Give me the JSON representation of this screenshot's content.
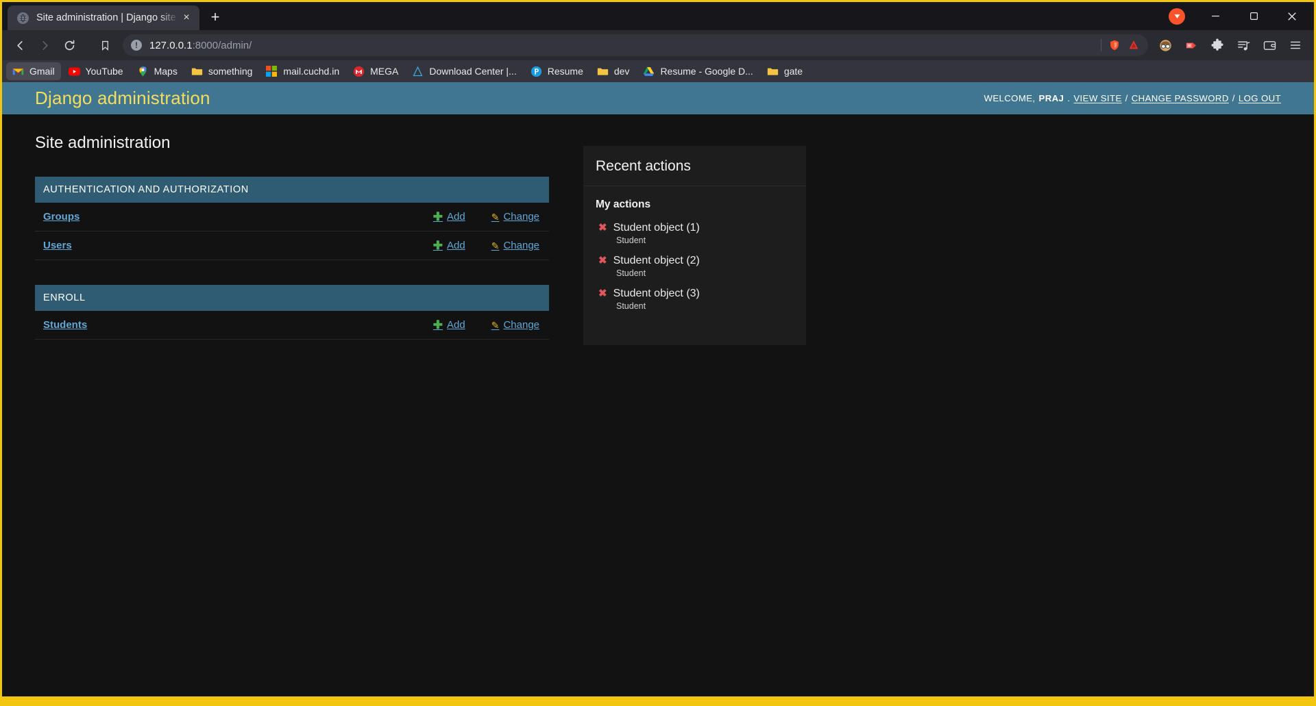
{
  "browser": {
    "tab": {
      "title": "Site administration | Django site a",
      "favicon": "globe-icon",
      "close": "×"
    },
    "new_tab_label": "+",
    "window_controls": {
      "minimize": "—",
      "maximize": "❐",
      "close": "✕"
    },
    "nav": {
      "back": "back-icon",
      "forward": "forward-icon",
      "reload": "reload-icon"
    },
    "omnibox": {
      "host": "127.0.0.1",
      "path": ":8000/admin/",
      "info_glyph": "!",
      "bookmark_icon": "bookmark-icon",
      "shield_icon": "brave-shield-icon",
      "leo_icon": "brave-leo-icon"
    },
    "toolbar_icons": [
      "profile-avatar-icon",
      "brave-rewards-icon",
      "extensions-puzzle-icon",
      "playlist-icon",
      "wallet-icon",
      "main-menu-icon"
    ],
    "bookmarks": [
      {
        "label": "Gmail",
        "icon": "gmail-icon",
        "active": true
      },
      {
        "label": "YouTube",
        "icon": "youtube-icon",
        "active": false
      },
      {
        "label": "Maps",
        "icon": "google-maps-icon",
        "active": false
      },
      {
        "label": "something",
        "icon": "folder-icon",
        "active": false
      },
      {
        "label": "mail.cuchd.in",
        "icon": "microsoft-icon",
        "active": false
      },
      {
        "label": "MEGA",
        "icon": "mega-icon",
        "active": false
      },
      {
        "label": "Download Center |...",
        "icon": "download-center-icon",
        "active": false
      },
      {
        "label": "Resume",
        "icon": "p-circle-icon",
        "active": false
      },
      {
        "label": "dev",
        "icon": "folder-icon",
        "active": false
      },
      {
        "label": "Resume - Google D...",
        "icon": "google-drive-icon",
        "active": false
      },
      {
        "label": "gate",
        "icon": "folder-icon",
        "active": false
      }
    ]
  },
  "django": {
    "branding": "Django administration",
    "user_tools": {
      "welcome_prefix": "Welcome,",
      "username": "PRAJ",
      "period": ".",
      "view_site": "View site",
      "change_password": "Change password",
      "log_out": "Log out",
      "separator": "/"
    },
    "page_title": "Site administration",
    "apps": [
      {
        "caption": "Authentication and Authorization",
        "models": [
          {
            "name": "Groups",
            "add": "Add",
            "change": "Change"
          },
          {
            "name": "Users",
            "add": "Add",
            "change": "Change"
          }
        ]
      },
      {
        "caption": "Enroll",
        "models": [
          {
            "name": "Students",
            "add": "Add",
            "change": "Change"
          }
        ]
      }
    ],
    "sidebar": {
      "title": "Recent actions",
      "subtitle": "My actions",
      "actions": [
        {
          "label": "Student object (1)",
          "model": "Student",
          "marker": "✖"
        },
        {
          "label": "Student object (2)",
          "model": "Student",
          "marker": "✖"
        },
        {
          "label": "Student object (3)",
          "model": "Student",
          "marker": "✖"
        }
      ]
    },
    "colors": {
      "header_bg": "#417690",
      "branding": "#f5dd5d",
      "module_caption_bg": "#2f5c72",
      "link": "#5fa8d8",
      "add": "#4caf50",
      "change": "#e8b71a",
      "delete_marker": "#e0585b"
    }
  }
}
